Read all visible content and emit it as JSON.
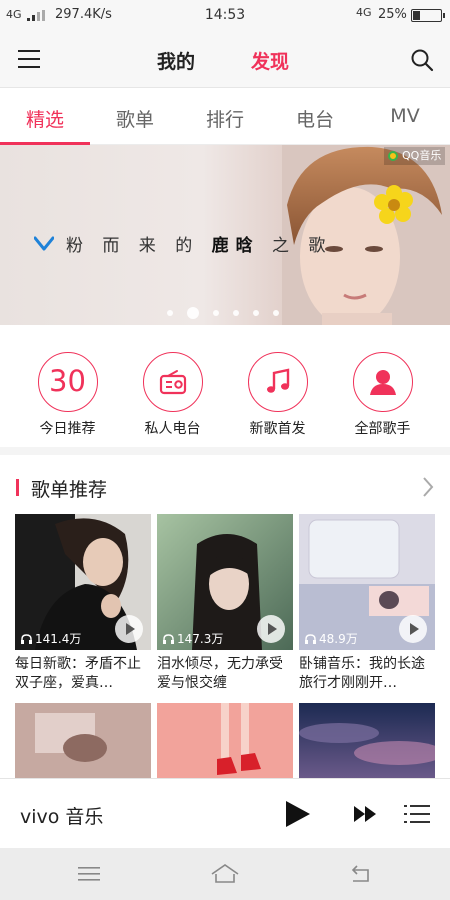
{
  "status_bar": {
    "network_left": "4G",
    "speed": "297.4K/s",
    "time": "14:53",
    "network_right": "4G",
    "battery_percent": "25%",
    "battery_level": 0.25
  },
  "header": {
    "tabs": [
      {
        "label": "我的",
        "active": false
      },
      {
        "label": "发现",
        "active": true
      }
    ],
    "icons": {
      "menu": "hamburger-menu-icon",
      "search": "search-icon"
    },
    "accent_color": "#f0325a"
  },
  "sub_tabs": [
    {
      "label": "精选",
      "active": true
    },
    {
      "label": "歌单",
      "active": false
    },
    {
      "label": "排行",
      "active": false
    },
    {
      "label": "电台",
      "active": false
    },
    {
      "label": "MV",
      "active": false
    }
  ],
  "banner": {
    "tagline_before": "粉 而 来 的",
    "tagline_highlight": "鹿晗",
    "tagline_after": "之 歌",
    "source_label": "QQ音乐",
    "page_count": 6,
    "active_page": 2
  },
  "quick_actions": [
    {
      "label": "今日推荐",
      "icon_text": "30",
      "icon": "calendar-30-icon"
    },
    {
      "label": "私人电台",
      "icon": "radio-icon"
    },
    {
      "label": "新歌首发",
      "icon": "music-note-icon"
    },
    {
      "label": "全部歌手",
      "icon": "person-icon"
    }
  ],
  "playlist_section": {
    "title": "歌单推荐",
    "items": [
      {
        "caption": "每日新歌：矛盾不止双子座，爱真…",
        "plays": "141.4万"
      },
      {
        "caption": "泪水倾尽，无力承受爱与恨交缠",
        "plays": "147.3万"
      },
      {
        "caption": "卧铺音乐：我的长途旅行才刚刚开…",
        "plays": "48.9万"
      }
    ]
  },
  "player": {
    "title": "vivo 音乐",
    "icons": {
      "play": "play-icon",
      "next": "fast-forward-icon",
      "list": "playlist-icon"
    }
  },
  "nav_bar": {
    "icons": [
      "menu-icon",
      "home-icon",
      "back-icon"
    ]
  }
}
